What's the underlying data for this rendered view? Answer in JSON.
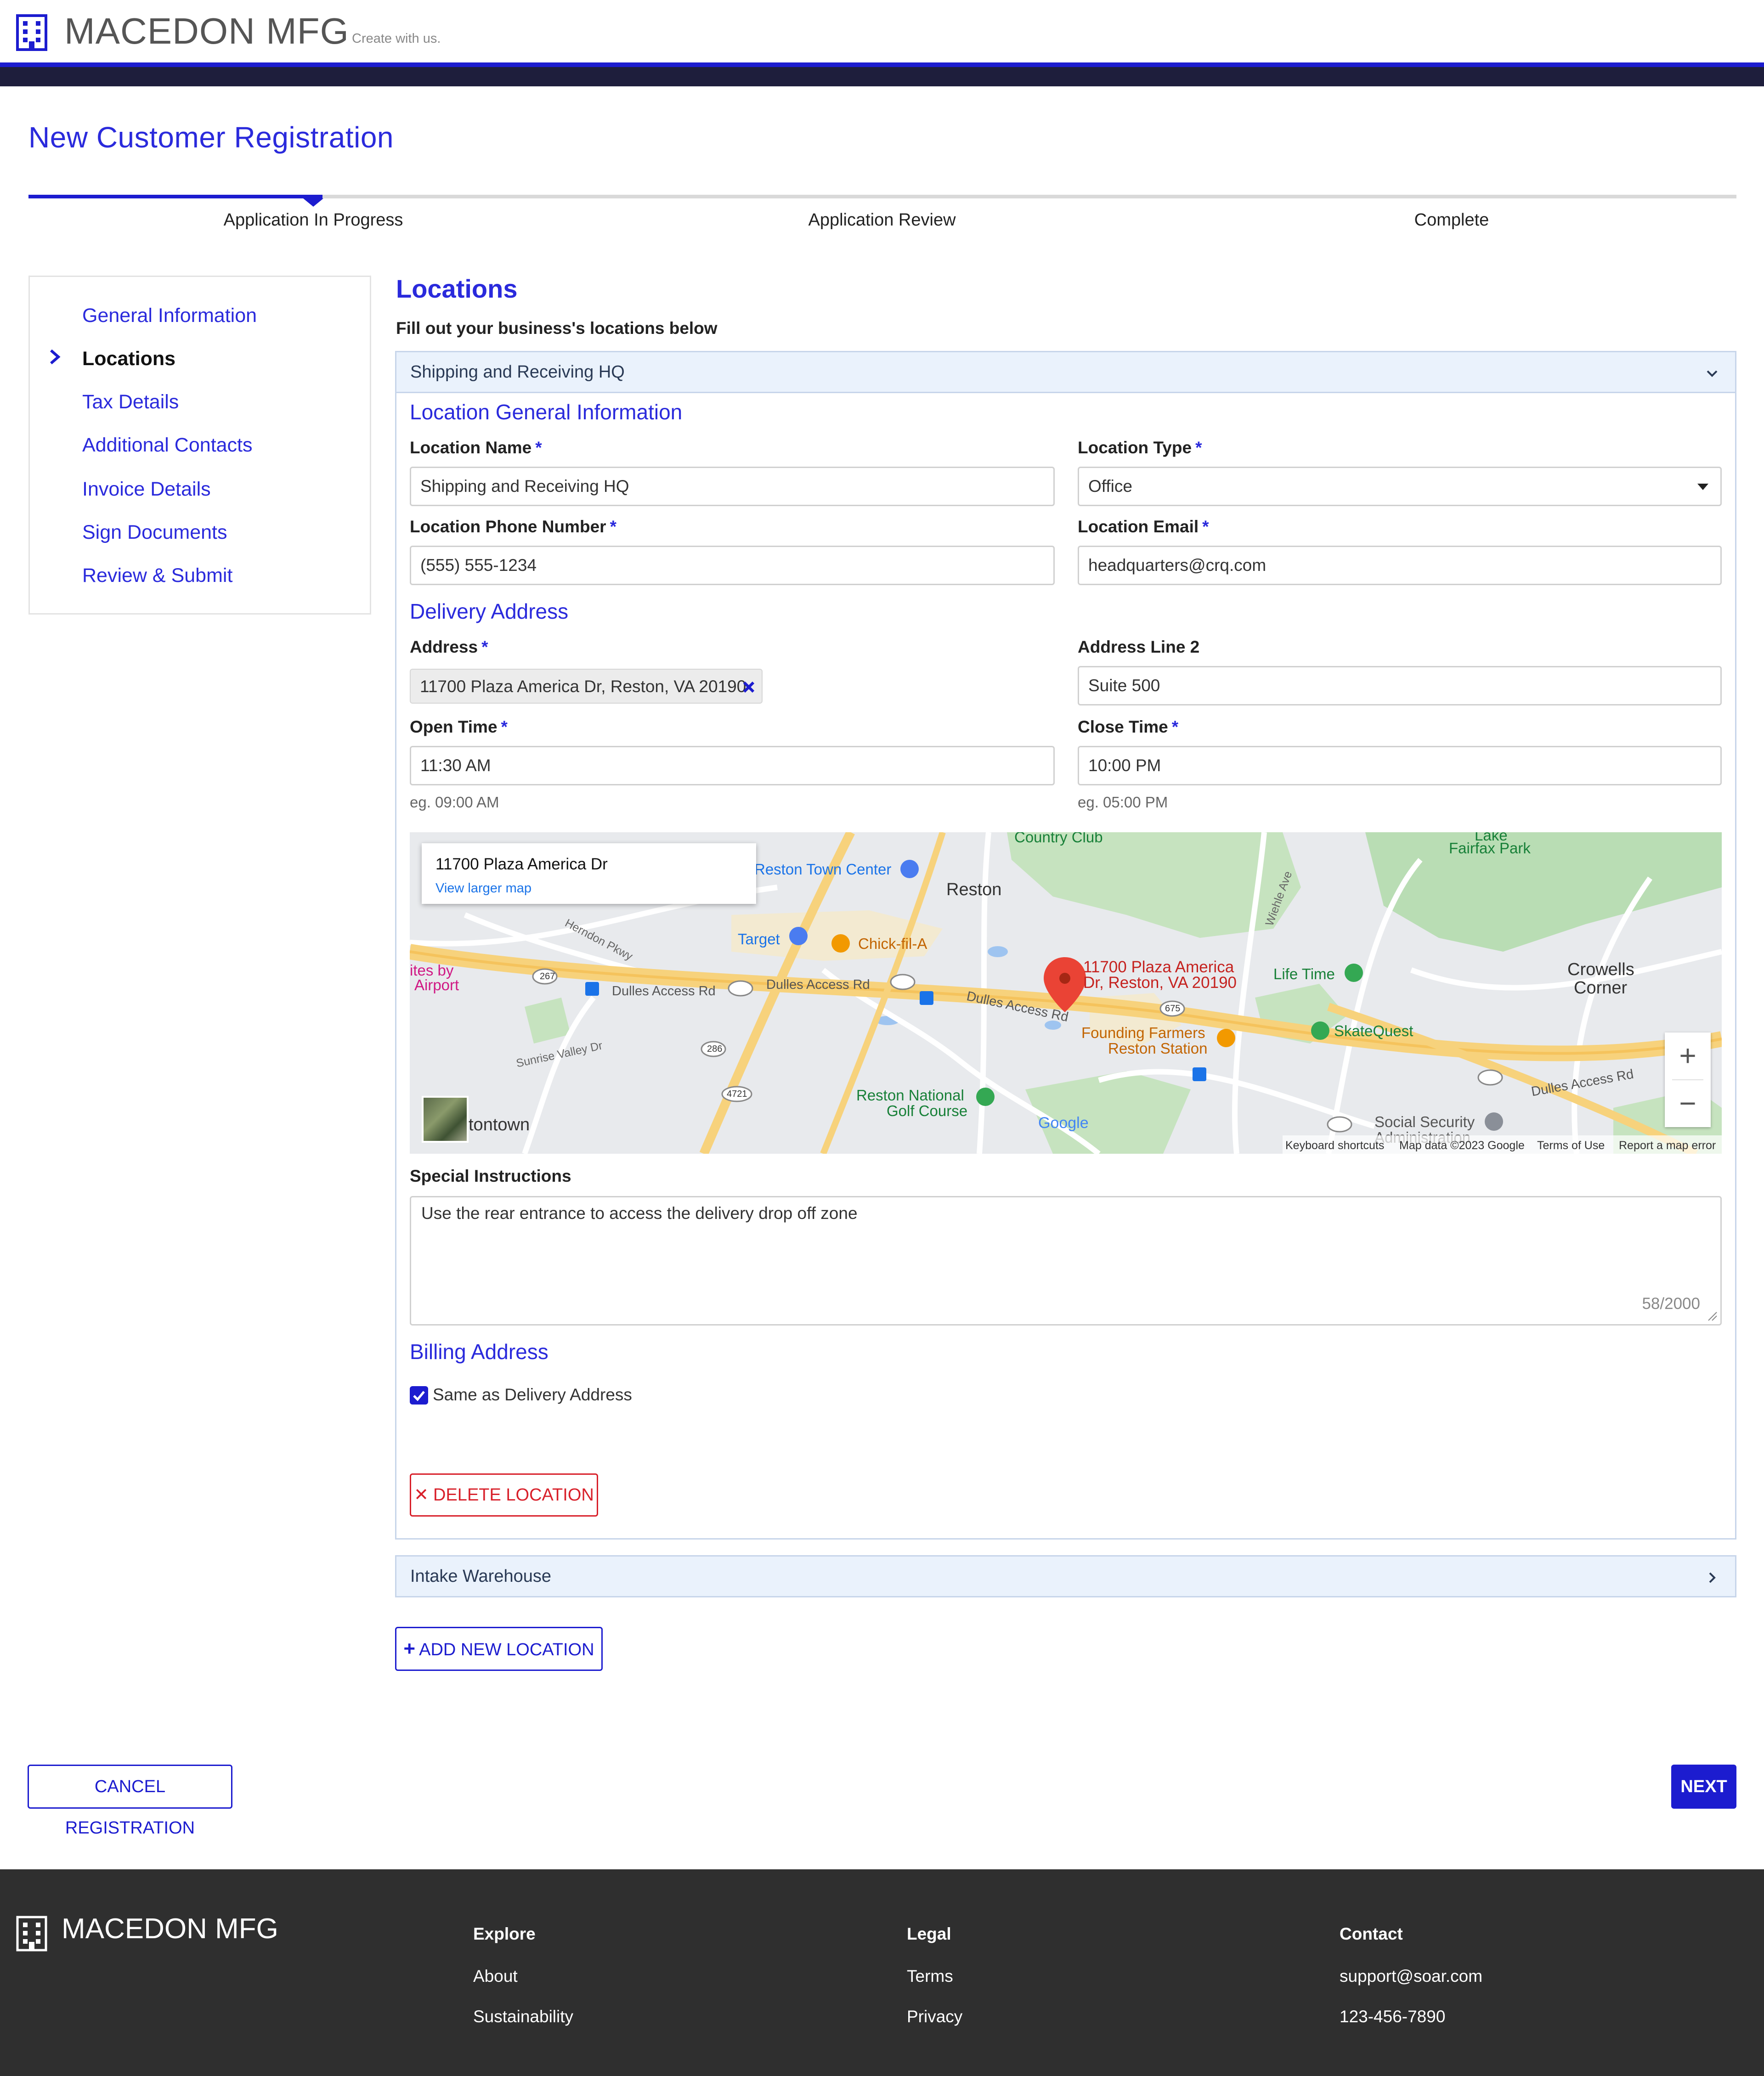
{
  "header": {
    "brand": "MACEDON MFG",
    "tagline": "Create with us.",
    "logo_icon": "building-icon"
  },
  "page_title": "New Customer Registration",
  "stepper": {
    "current_step": 1,
    "steps": [
      {
        "label": "Application In Progress"
      },
      {
        "label": "Application Review"
      },
      {
        "label": "Complete"
      }
    ]
  },
  "sidebar": {
    "items": [
      {
        "label": "General Information"
      },
      {
        "label": "Locations",
        "active": true
      },
      {
        "label": "Tax Details"
      },
      {
        "label": "Additional Contacts"
      },
      {
        "label": "Invoice Details"
      },
      {
        "label": "Sign Documents"
      },
      {
        "label": "Review & Submit"
      }
    ]
  },
  "main": {
    "title": "Locations",
    "subtitle": "Fill out your business's locations below",
    "locations": [
      {
        "header": "Shipping and Receiving HQ",
        "expanded": true,
        "general_heading": "Location General Information",
        "name_label": "Location Name",
        "name_value": "Shipping and Receiving HQ",
        "type_label": "Location Type",
        "type_value": "Office",
        "phone_label": "Location Phone Number",
        "phone_value": "(555) 555-1234",
        "email_label": "Location Email",
        "email_value": "headquarters@crq.com",
        "delivery_heading": "Delivery Address",
        "address_label": "Address",
        "address_value": "11700 Plaza America Dr, Reston, VA 20190",
        "address2_label": "Address Line 2",
        "address2_value": "Suite 500",
        "open_label": "Open Time",
        "open_value": "11:30 AM",
        "open_hint": "eg. 09:00 AM",
        "close_label": "Close Time",
        "close_value": "10:00 PM",
        "close_hint": "eg. 05:00 PM",
        "special_label": "Special Instructions",
        "special_value": "Use the rear entrance to access the delivery drop off zone",
        "special_count": "58/2000",
        "billing_heading": "Billing Address",
        "billing_same_label": "Same as Delivery Address",
        "billing_same_checked": true,
        "delete_label": "DELETE LOCATION"
      },
      {
        "header": "Intake Warehouse",
        "expanded": false
      }
    ],
    "add_label": "ADD NEW LOCATION"
  },
  "map": {
    "card_title": "11700 Plaza America Dr",
    "card_link": "View larger map",
    "pin_label_1": "11700 Plaza America",
    "pin_label_2": "Dr, Reston, VA 20190",
    "zoom_in": "+",
    "zoom_out": "−",
    "labels": {
      "reston": "Reston",
      "reston_town_center": "Reston Town Center",
      "target": "Target",
      "chick": "Chick-fil-A",
      "country_club": "Country Club",
      "lake_fairfax_1": "Lake",
      "lake_fairfax_2": "Fairfax Park",
      "crowells_1": "Crowells",
      "crowells_2": "Corner",
      "life_time": "Life Time",
      "skatequest": "SkateQuest",
      "founding_1": "Founding Farmers",
      "founding_2": "Reston Station",
      "reston_national_1": "Reston National",
      "reston_national_2": "Golf Course",
      "social_security_1": "Social Security",
      "social_security_2": "Administration",
      "tontown": "tontown",
      "suites_1": "ites by",
      "suites_2": "Airport",
      "dulles_1": "Dulles Access Rd",
      "dulles_2": "Dulles Access Rd",
      "dulles_3": "Dulles Access Rd",
      "dulles_4": "Dulles Access Rd",
      "herndon": "Herndon Pkwy",
      "sunrise": "Sunrise Valley Dr",
      "wiehle": "Wiehle Ave",
      "r267": "267",
      "r286": "286",
      "r4721": "4721",
      "r675": "675",
      "google": "Google"
    },
    "footer": {
      "shortcuts": "Keyboard shortcuts",
      "mapdata": "Map data ©2023 Google",
      "terms": "Terms of Use",
      "report": "Report a map error"
    }
  },
  "actions": {
    "cancel_label": "CANCEL REGISTRATION",
    "next_label": "NEXT"
  },
  "footer": {
    "brand": "MACEDON MFG",
    "columns": [
      {
        "heading": "Explore",
        "links": [
          "About",
          "Sustainability"
        ]
      },
      {
        "heading": "Legal",
        "links": [
          "Terms",
          "Privacy"
        ]
      },
      {
        "heading": "Contact",
        "links": [
          "support@soar.com",
          "123-456-7890"
        ]
      }
    ]
  },
  "colors": {
    "brand_blue": "#1c1ccf",
    "link_blue": "#2a2adc",
    "danger_red": "#d8202a",
    "footer_bg": "#2f2f2f",
    "accordion_bg": "#eaf2fc"
  }
}
